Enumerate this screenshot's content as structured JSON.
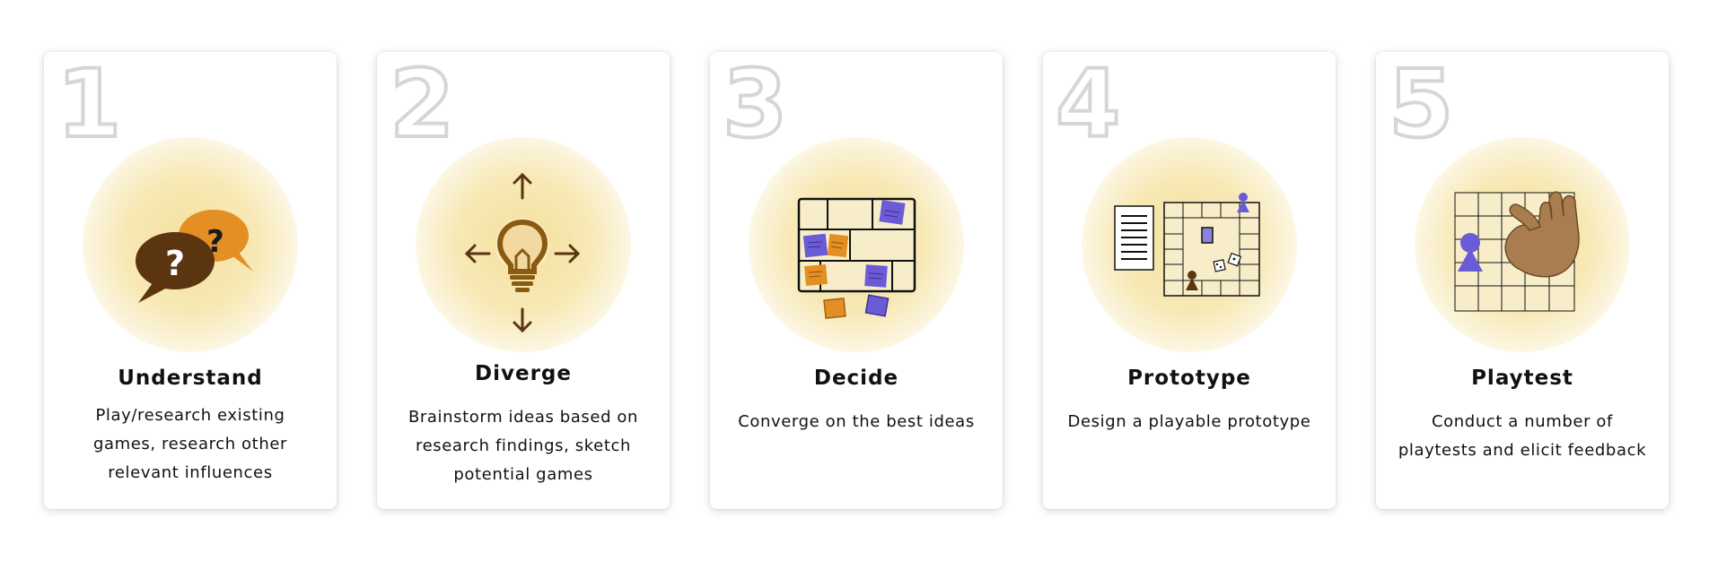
{
  "colors": {
    "glow": "#f4de96",
    "brown_dark": "#5b3410",
    "orange": "#e48f24",
    "bulb_brown": "#8a5a12",
    "purple": "#6b5bd6",
    "hand": "#a97d4f",
    "number_outline": "#d6d6d6"
  },
  "steps": [
    {
      "number": "1",
      "title": "Understand",
      "description": "Play/research existing games, research other relevant influences",
      "icon": "speech-bubbles-question-icon"
    },
    {
      "number": "2",
      "title": "Diverge",
      "description": "Brainstorm ideas based on research findings, sketch potential games",
      "icon": "lightbulb-arrows-icon"
    },
    {
      "number": "3",
      "title": "Decide",
      "description": "Converge on the best ideas",
      "icon": "sticky-notes-board-icon"
    },
    {
      "number": "4",
      "title": "Prototype",
      "description": "Design a playable prototype",
      "icon": "board-game-prototype-icon"
    },
    {
      "number": "5",
      "title": "Playtest",
      "description": "Conduct a number of playtests and elicit feedback",
      "icon": "hand-pawn-board-icon"
    }
  ]
}
